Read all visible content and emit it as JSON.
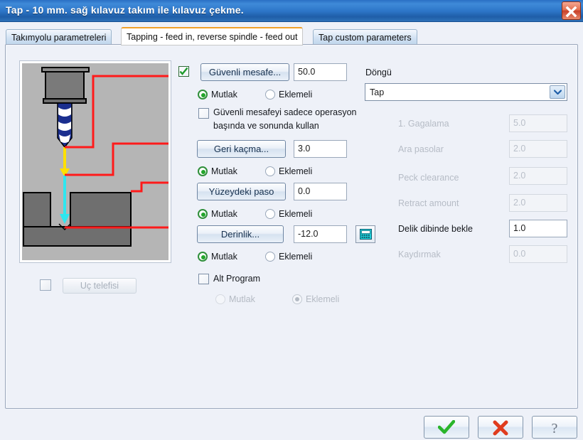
{
  "window": {
    "title": "Tap - 10 mm. sağ kılavuz takım ile kılavuz çekme.",
    "close_label": "×",
    "titlebar_color": "#2d76c8",
    "close_color": "#c8412a"
  },
  "tabs": [
    {
      "label": "Takımyolu parametreleri",
      "active": false
    },
    {
      "label": "Tapping - feed in, reverse spindle - feed out",
      "active": true
    },
    {
      "label": "Tap custom parameters",
      "active": false
    }
  ],
  "preview": {
    "name": "tool-path-diagram",
    "colors": {
      "stock": "#b5b5b5",
      "material": "#6f6f6f",
      "toolpath": "#ff1a1a",
      "rapid": "#ffe000",
      "feed": "#2ee6f0",
      "tool_body": "#7a7a7a",
      "flute": "#1b2f8f"
    }
  },
  "tip_comp": {
    "checkbox_checked": false,
    "button_label": "Uç telefisi",
    "enabled": false
  },
  "left_form": {
    "enable_checkbox": {
      "label": "",
      "checked": true
    },
    "rows": [
      {
        "name": "safety-distance",
        "button_label": "Güvenli mesafe...",
        "value": "50.0",
        "mode": {
          "absolute_label": "Mutlak",
          "incremental_label": "Eklemeli",
          "selected": "absolute"
        }
      },
      {
        "name": "retract",
        "button_label": "Geri kaçma...",
        "value": "3.0",
        "mode": {
          "absolute_label": "Mutlak",
          "incremental_label": "Eklemeli",
          "selected": "absolute"
        }
      },
      {
        "name": "top-of-stock",
        "button_label": "Yüzeydeki paso",
        "value": "0.0",
        "mode": {
          "absolute_label": "Mutlak",
          "incremental_label": "Eklemeli",
          "selected": "absolute"
        }
      },
      {
        "name": "depth",
        "button_label": "Derinlik...",
        "value": "-12.0",
        "mode": {
          "absolute_label": "Mutlak",
          "incremental_label": "Eklemeli",
          "selected": "absolute"
        }
      }
    ],
    "safety_only_checkbox": {
      "checked": false,
      "line1": "Güvenli mesafeyi sadece operasyon",
      "line2": "başında ve sonunda kullan"
    },
    "subprogram": {
      "label": "Alt Program",
      "checked": false,
      "absolute_label": "Mutlak",
      "incremental_label": "Eklemeli",
      "selected": "incremental",
      "enabled": false
    }
  },
  "right_form": {
    "cycle_label": "Döngü",
    "cycle_value": "Tap",
    "cycle_options": [
      "Tap"
    ],
    "params": [
      {
        "name": "first-peck",
        "label": "1. Gagalama",
        "value": "5.0",
        "enabled": false
      },
      {
        "name": "subsequent-peck",
        "label": "Ara pasolar",
        "value": "2.0",
        "enabled": false
      },
      {
        "name": "peck-clearance",
        "label": "Peck clearance",
        "value": "2.0",
        "enabled": false
      },
      {
        "name": "retract-amount",
        "label": "Retract amount",
        "value": "2.0",
        "enabled": false
      },
      {
        "name": "dwell",
        "label": "Delik dibinde bekle",
        "value": "1.0",
        "enabled": true
      },
      {
        "name": "shift",
        "label": "Kaydırmak",
        "value": "0.0",
        "enabled": false
      }
    ]
  },
  "footer": {
    "ok_icon": "check-icon",
    "cancel_icon": "cross-icon",
    "help_icon": "question-icon",
    "ok_color": "#2ab52a",
    "cancel_color": "#e03c1e",
    "help_color": "#6b7480"
  }
}
